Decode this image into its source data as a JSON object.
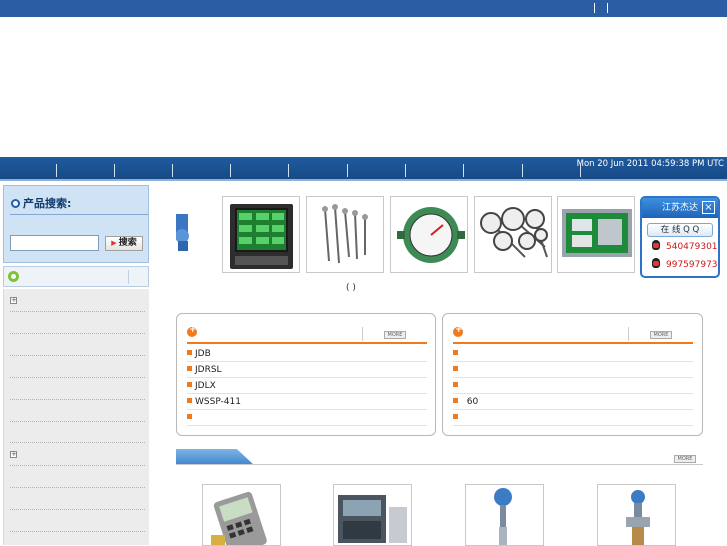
{
  "header": {
    "separators": 2
  },
  "nav": {
    "datetime": "Mon 20 Jun 2011 04:59:38 PM UTC"
  },
  "sidebar": {
    "search_title": "产品搜索:",
    "search_value": "",
    "search_button": "搜索"
  },
  "strip": {
    "caption": "( )"
  },
  "qq": {
    "title": "江苏杰达",
    "online_label": "在 线 Q Q",
    "contacts": [
      "540479301",
      "997597973"
    ]
  },
  "news_left": {
    "items": [
      "JDB",
      "JDRSL",
      "JDLX",
      "WSSP-411",
      ""
    ]
  },
  "news_right": {
    "items": [
      "",
      "",
      "",
      "60",
      ""
    ]
  },
  "more_label": "MORE",
  "colors": {
    "brand_blue": "#2a5da4",
    "accent_orange": "#f07a1c",
    "qq_red": "#d01818"
  }
}
